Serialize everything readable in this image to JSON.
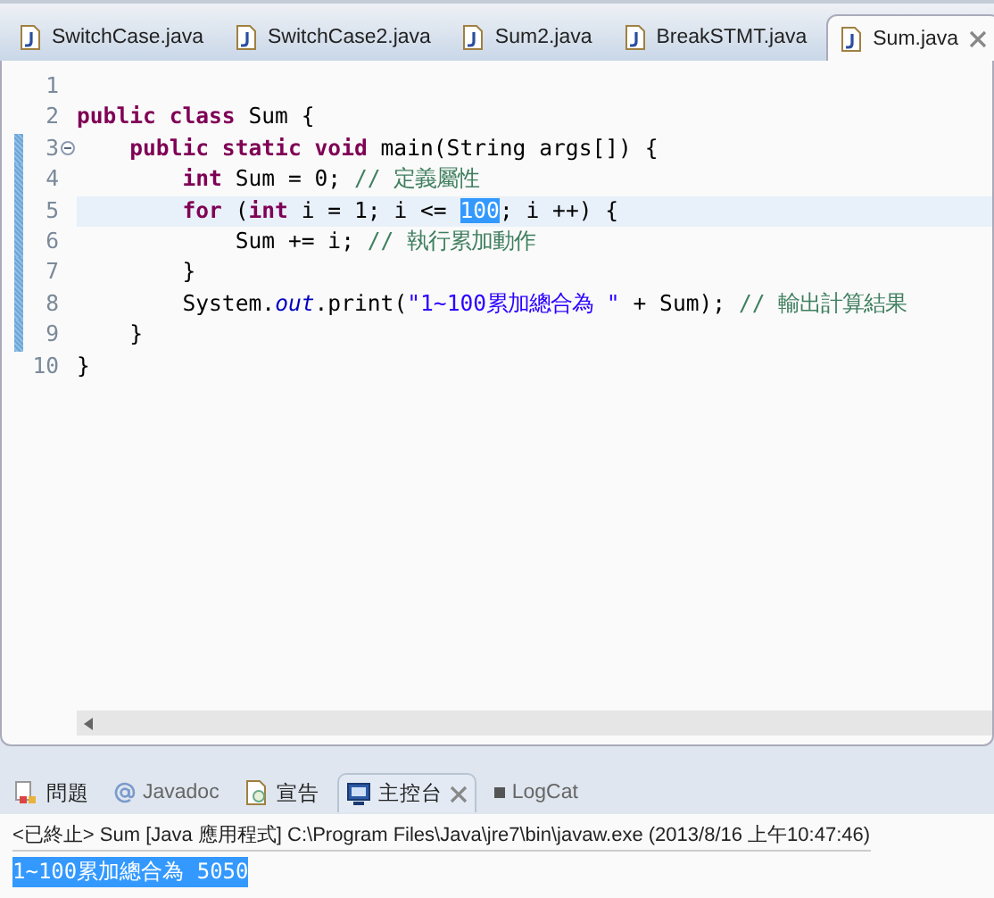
{
  "editor_tabs": [
    {
      "label": "SwitchCase.java",
      "selected": false
    },
    {
      "label": "SwitchCase2.java",
      "selected": false
    },
    {
      "label": "Sum2.java",
      "selected": false
    },
    {
      "label": "BreakSTMT.java",
      "selected": false
    },
    {
      "label": "Sum.java",
      "selected": true
    }
  ],
  "code_lines": [
    {
      "number": "1",
      "current": false,
      "changed": false
    },
    {
      "number": "2",
      "current": false,
      "changed": false,
      "tokens": [
        {
          "kind": "keyword",
          "text": "public class"
        },
        {
          "kind": "plain",
          "text": " Sum {"
        }
      ]
    },
    {
      "number": "3",
      "current": false,
      "changed": true,
      "foldable": true,
      "tokens": [
        {
          "kind": "keyword",
          "text": "    public static void"
        },
        {
          "kind": "plain",
          "text": " main(String args[]) {"
        }
      ]
    },
    {
      "number": "4",
      "current": false,
      "changed": true,
      "tokens": [
        {
          "kind": "keyword",
          "text": "        int"
        },
        {
          "kind": "plain",
          "text": " Sum = 0; "
        },
        {
          "kind": "comment",
          "text": "// 定義屬性"
        }
      ]
    },
    {
      "number": "5",
      "current": true,
      "changed": true,
      "tokens": [
        {
          "kind": "keyword",
          "text": "        for"
        },
        {
          "kind": "plain",
          "text": " ("
        },
        {
          "kind": "keyword",
          "text": "int"
        },
        {
          "kind": "plain",
          "text": " i = 1; i <= "
        },
        {
          "kind": "selection",
          "text": "100"
        },
        {
          "kind": "plain",
          "text": "; i ++) {"
        }
      ]
    },
    {
      "number": "6",
      "current": false,
      "changed": true,
      "tokens": [
        {
          "kind": "plain",
          "text": "            Sum += i; "
        },
        {
          "kind": "comment",
          "text": "// 執行累加動作"
        }
      ]
    },
    {
      "number": "7",
      "current": false,
      "changed": true,
      "tokens": [
        {
          "kind": "plain",
          "text": "        }"
        }
      ]
    },
    {
      "number": "8",
      "current": false,
      "changed": true,
      "tokens": [
        {
          "kind": "plain",
          "text": "        System."
        },
        {
          "kind": "field",
          "text": "out"
        },
        {
          "kind": "plain",
          "text": ".print("
        },
        {
          "kind": "string",
          "text": "\"1~100累加總合為 \""
        },
        {
          "kind": "plain",
          "text": " + Sum); "
        },
        {
          "kind": "comment",
          "text": "// 輸出計算結果"
        }
      ]
    },
    {
      "number": "9",
      "current": false,
      "changed": true,
      "tokens": [
        {
          "kind": "plain",
          "text": "    }"
        }
      ]
    },
    {
      "number": "10",
      "current": false,
      "changed": false,
      "tokens": [
        {
          "kind": "plain",
          "text": "}"
        }
      ]
    }
  ],
  "console_tabs": [
    {
      "label": "問題",
      "kind": "problems",
      "selected": false
    },
    {
      "label": "Javadoc",
      "kind": "javadoc",
      "selected": false
    },
    {
      "label": "宣告",
      "kind": "declaration",
      "selected": false
    },
    {
      "label": "主控台",
      "kind": "console",
      "selected": true
    },
    {
      "label": "LogCat",
      "kind": "logcat",
      "selected": false
    }
  ],
  "console": {
    "status": "<已終止> Sum [Java 應用程式] C:\\Program Files\\Java\\jre7\\bin\\javaw.exe (2013/8/16 上午10:47:46)",
    "output": "1~100累加總合為 5050",
    "output_selected": true
  }
}
